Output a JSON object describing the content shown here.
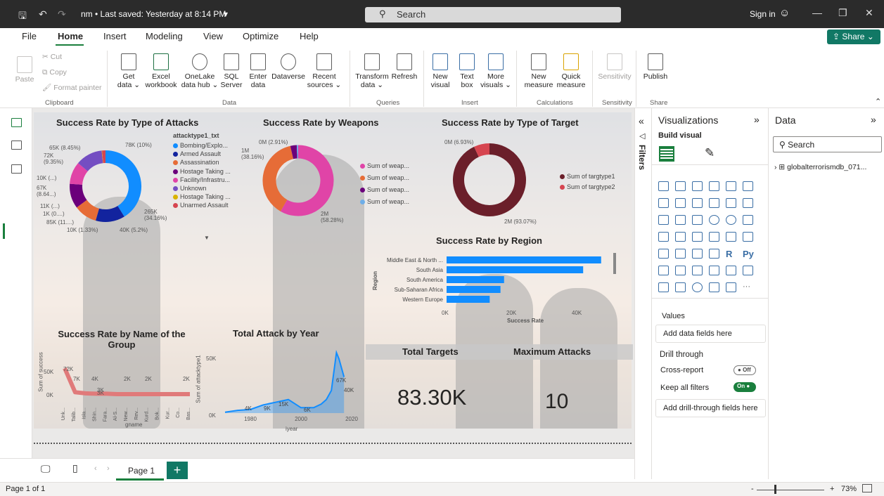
{
  "window": {
    "title": "nm • Last saved: Yesterday at 8:14 PM",
    "search_placeholder": "Search",
    "sign_in": "Sign in"
  },
  "menu": {
    "tabs": [
      "File",
      "Home",
      "Insert",
      "Modeling",
      "View",
      "Optimize",
      "Help"
    ],
    "active": "Home",
    "share_label": "Share"
  },
  "ribbon": {
    "clipboard": {
      "paste": "Paste",
      "cut": "Cut",
      "copy": "Copy",
      "format_painter": "Format painter",
      "group": "Clipboard"
    },
    "data": {
      "get_data": "Get\ndata ⌄",
      "excel": "Excel\nworkbook",
      "onelake": "OneLake\ndata hub ⌄",
      "sql": "SQL\nServer",
      "enter_data": "Enter\ndata",
      "dataverse": "Dataverse",
      "recent": "Recent\nsources ⌄",
      "group": "Data"
    },
    "queries": {
      "transform": "Transform\ndata ⌄",
      "refresh": "Refresh",
      "group": "Queries"
    },
    "insert": {
      "new_visual": "New\nvisual",
      "text_box": "Text\nbox",
      "more_visuals": "More\nvisuals ⌄",
      "group": "Insert"
    },
    "calculations": {
      "new_measure": "New\nmeasure",
      "quick_measure": "Quick\nmeasure",
      "group": "Calculations"
    },
    "sensitivity": {
      "sensitivity": "Sensitivity",
      "group": "Sensitivity"
    },
    "share": {
      "publish": "Publish",
      "group": "Share"
    }
  },
  "report": {
    "attacks": {
      "title": "Success Rate by Type of Attacks",
      "legend_title": "attacktype1_txt",
      "legend": [
        "Bombing/Explo...",
        "Armed Assault",
        "Assassination",
        "Hostage Taking ...",
        "Facility/Infrastru...",
        "Unknown",
        "Hostage Taking ...",
        "Unarmed Assault"
      ],
      "labels": [
        "78K (10%)",
        "65K (8.45%)",
        "72K (9.35%)",
        "10K (...)",
        "67K (8.64...)",
        "11K (...)",
        "1K (0....)",
        "85K (11....)",
        "10K (1.33%)",
        "40K (5.2%)",
        "265K (34.16%)"
      ]
    },
    "weapons": {
      "title": "Success Rate by Weapons",
      "legend": [
        "Sum of weap...",
        "Sum of weap...",
        "Sum of weap...",
        "Sum of weap..."
      ],
      "labels": [
        "0M (2.91%)",
        "1M (38.16%)",
        "2M (58.28%)"
      ]
    },
    "target": {
      "title": "Success Rate by Type of Target",
      "legend": [
        "Sum of targtype1",
        "Sum of targtype2"
      ],
      "labels": [
        "0M (6.93%)",
        "2M (93.07%)"
      ]
    },
    "region": {
      "title": "Success Rate by Region",
      "xlabel": "Success Rate",
      "ylabel": "Region",
      "ticks": [
        "0K",
        "20K",
        "40K"
      ]
    },
    "group": {
      "title": "Success Rate by Name of the Group",
      "ylabel": "Sum of success",
      "xlabel": "gname",
      "yticks": [
        "50K",
        "0K"
      ],
      "labels": [
        "72K",
        "7K",
        "4K",
        "3K",
        "3K",
        "2K",
        "2K",
        "2K"
      ],
      "xticks": [
        "Unk...",
        "Talib...",
        "Isla...",
        "Shin...",
        "Fara...",
        "Al-S...",
        "New...",
        "Rev...",
        "Kurd...",
        "Bok...",
        "Kur...",
        "Co...",
        "Bas..."
      ]
    },
    "year": {
      "title": "Total Attack by Year",
      "ylabel": "Sum of attacktype1",
      "xlabel": "iyear",
      "yticks": [
        "50K",
        "0K"
      ],
      "xticks": [
        "1980",
        "2000",
        "2020"
      ],
      "labels": [
        "4K",
        "9K",
        "15K",
        "6K",
        "67K",
        "40K"
      ]
    },
    "total_targets": {
      "title": "Total Targets",
      "value": "83.30K"
    },
    "max_attacks": {
      "title": "Maximum Attacks",
      "value": "10"
    }
  },
  "pages": {
    "tab": "Page 1",
    "status": "Page 1 of 1",
    "zoom": "73%"
  },
  "filters": {
    "label": "Filters"
  },
  "visualizations": {
    "title": "Visualizations",
    "build": "Build visual",
    "values": "Values",
    "add_fields": "Add data fields here",
    "drill": "Drill through",
    "cross_report": "Cross-report",
    "cross_state": "Off",
    "keep_filters": "Keep all filters",
    "keep_state": "On",
    "add_drill": "Add drill-through fields here"
  },
  "data_pane": {
    "title": "Data",
    "search": "Search",
    "table": "globalterrorismdb_071..."
  },
  "colors": {
    "accent": "#117865",
    "blue": "#118DFF",
    "navy": "#12239E",
    "orange": "#E66C37",
    "magenta": "#E044A7",
    "purple": "#6B007B",
    "violet": "#744EC2",
    "gold": "#D9B300",
    "red": "#D64550",
    "maroon": "#6B1F2A",
    "salmon": "#E07A7A"
  },
  "chart_data": [
    {
      "type": "pie",
      "title": "Success Rate by Type of Attacks",
      "categories": [
        "Bombing/Explo...",
        "Armed Assault",
        "Assassination",
        "Hostage Taking ...",
        "Facility/Infrastru...",
        "Unknown",
        "Hostage Taking ...",
        "Unarmed Assault"
      ],
      "values": [
        265,
        85,
        67,
        72,
        65,
        78,
        1,
        10
      ]
    },
    {
      "type": "pie",
      "title": "Success Rate by Weapons",
      "categories": [
        "Sum of weap...",
        "Sum of weap...",
        "Sum of weap...",
        "Sum of weap..."
      ],
      "values": [
        58.28,
        38.16,
        2.91,
        0.65
      ]
    },
    {
      "type": "pie",
      "title": "Success Rate by Type of Target",
      "categories": [
        "Sum of targtype1",
        "Sum of targtype2"
      ],
      "values": [
        93.07,
        6.93
      ]
    },
    {
      "type": "bar",
      "title": "Success Rate by Region",
      "categories": [
        "Middle East & North ...",
        "South Asia",
        "South America",
        "Sub-Saharan Africa",
        "Western Europe"
      ],
      "values": [
        43,
        38,
        16,
        15,
        12
      ],
      "xlim": [
        0,
        45
      ],
      "xlabel": "Success Rate",
      "ylabel": "Region"
    },
    {
      "type": "line",
      "title": "Success Rate by Name of the Group",
      "categories": [
        "Unk...",
        "Talib...",
        "Isla...",
        "Shin...",
        "Fara...",
        "Al-S...",
        "New...",
        "Rev...",
        "Kurd...",
        "Bok...",
        "Kur...",
        "Co...",
        "Bas..."
      ],
      "values": [
        72,
        7,
        4,
        3,
        3,
        2,
        2,
        2,
        2,
        2,
        2,
        2,
        2
      ],
      "ylim": [
        0,
        80
      ],
      "ylabel": "Sum of success",
      "xlabel": "gname"
    },
    {
      "type": "area",
      "title": "Total Attack by Year",
      "x": [
        1970,
        1975,
        1980,
        1985,
        1990,
        1995,
        2000,
        2005,
        2008,
        2010,
        2012,
        2014,
        2015,
        2016,
        2017
      ],
      "values": [
        1,
        3,
        4,
        9,
        12,
        15,
        6,
        6,
        10,
        15,
        25,
        67,
        60,
        50,
        40
      ],
      "xlim": [
        1970,
        2020
      ],
      "ylim": [
        0,
        70
      ],
      "ylabel": "Sum of attacktype1",
      "xlabel": "iyear"
    }
  ]
}
